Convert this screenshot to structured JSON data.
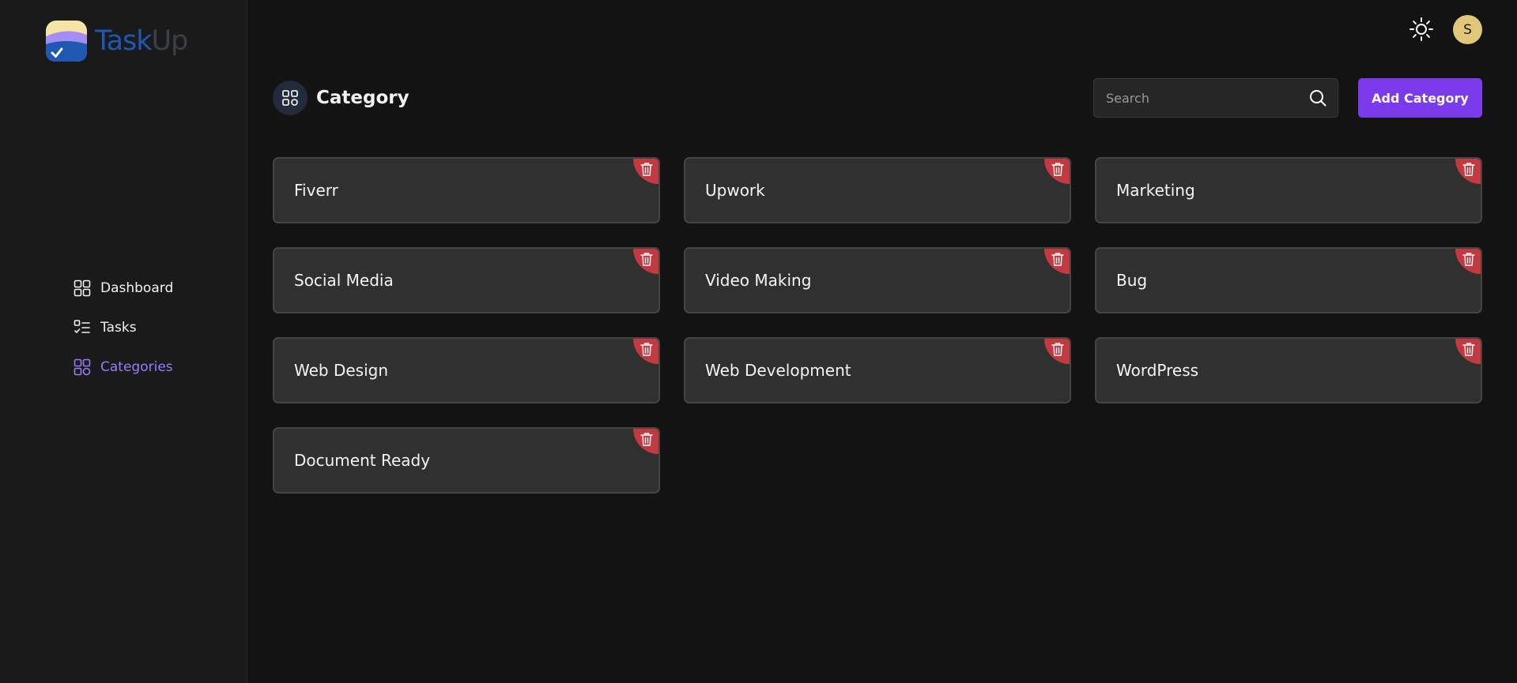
{
  "brand": {
    "part1": "Task",
    "part2": "Up"
  },
  "sidebar": {
    "items": [
      {
        "label": "Dashboard",
        "icon": "dashboard-grid-icon",
        "active": false
      },
      {
        "label": "Tasks",
        "icon": "task-list-icon",
        "active": false
      },
      {
        "label": "Categories",
        "icon": "categories-grid-icon",
        "active": true
      }
    ]
  },
  "topbar": {
    "avatar_initial": "S",
    "theme_icon": "sun-icon"
  },
  "header": {
    "title": "Category"
  },
  "search": {
    "placeholder": "Search"
  },
  "actions": {
    "add_label": "Add Category"
  },
  "categories": [
    {
      "name": "Fiverr"
    },
    {
      "name": "Upwork"
    },
    {
      "name": "Marketing"
    },
    {
      "name": "Social Media"
    },
    {
      "name": "Video Making"
    },
    {
      "name": "Bug"
    },
    {
      "name": "Web Design"
    },
    {
      "name": "Web Development"
    },
    {
      "name": "WordPress"
    },
    {
      "name": "Document Ready"
    }
  ],
  "colors": {
    "accent": "#7c3aed",
    "active_nav": "#9b7cf7",
    "delete": "#c4393f",
    "avatar": "#e2c77a"
  }
}
